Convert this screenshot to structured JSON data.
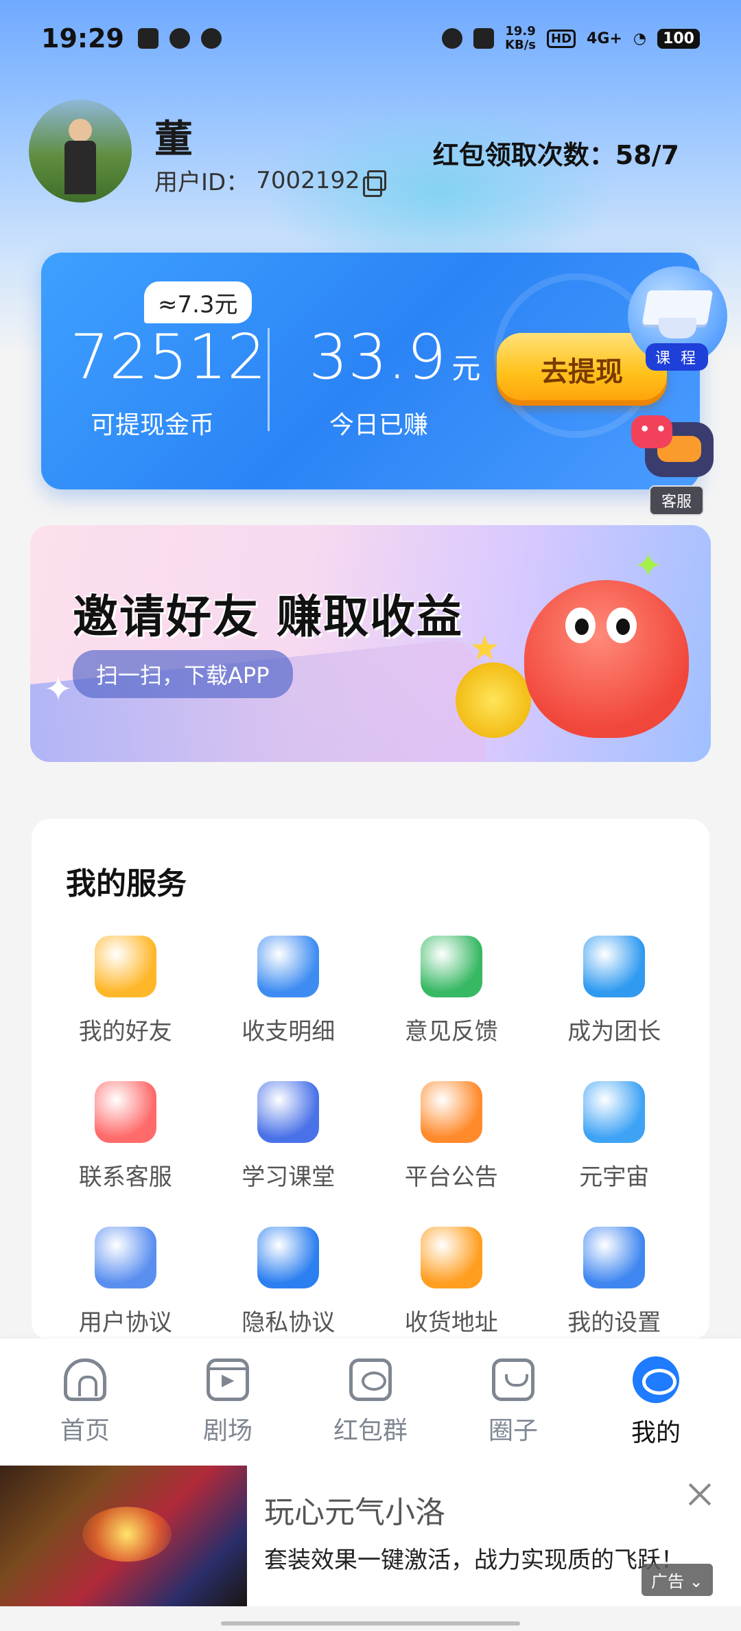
{
  "status_bar": {
    "time": "19:29",
    "net_speed_value": "19.9",
    "net_speed_unit": "KB/s",
    "hd": "HD",
    "signal": "4G+",
    "battery": "100"
  },
  "profile": {
    "name": "董",
    "user_id_label": "用户ID：",
    "user_id": "7002192",
    "redpacket_count": "红包领取次数：58/7"
  },
  "wallet": {
    "approx_badge": "≈7.3元",
    "coins_value": "72512",
    "coins_label": "可提现金币",
    "earned_value": "33.9",
    "earned_unit": "元",
    "earned_label": "今日已赚",
    "withdraw_button": "去提现"
  },
  "floating": {
    "course_label": "课 程",
    "service_label": "客服"
  },
  "banner": {
    "title": "邀请好友  赚取收益",
    "scan_label": "扫一扫，下载APP"
  },
  "services": {
    "title": "我的服务",
    "items": [
      {
        "label": "我的好友",
        "icon": "friends-icon",
        "color": "#ffb72a"
      },
      {
        "label": "收支明细",
        "icon": "ledger-icon",
        "color": "#3e8cf2"
      },
      {
        "label": "意见反馈",
        "icon": "feedback-icon",
        "color": "#37b863"
      },
      {
        "label": "成为团长",
        "icon": "leader-icon",
        "color": "#2f9af0"
      },
      {
        "label": "联系客服",
        "icon": "chat-icon",
        "color": "#ff6a6a"
      },
      {
        "label": "学习课堂",
        "icon": "books-icon",
        "color": "#4a72e8"
      },
      {
        "label": "平台公告",
        "icon": "announcement-icon",
        "color": "#ff8a2c"
      },
      {
        "label": "元宇宙",
        "icon": "globe-icon",
        "color": "#3fa3f5"
      },
      {
        "label": "用户协议",
        "icon": "agreement-icon",
        "color": "#5a8ff0"
      },
      {
        "label": "隐私协议",
        "icon": "privacy-shield-icon",
        "color": "#2b7ff0"
      },
      {
        "label": "收货地址",
        "icon": "location-pin-icon",
        "color": "#ff9e1f"
      },
      {
        "label": "我的设置",
        "icon": "settings-gear-icon",
        "color": "#3f86f0"
      }
    ]
  },
  "nav": {
    "home": "首页",
    "theater": "剧场",
    "group": "红包群",
    "circle": "圈子",
    "mine": "我的"
  },
  "ad": {
    "title": "玩心元气小洛",
    "desc": "套装效果一键激活，战力实现质的飞跃！",
    "tag": "广告"
  }
}
